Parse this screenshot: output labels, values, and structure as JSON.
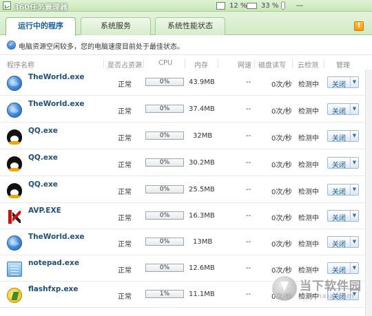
{
  "window": {
    "title": "360任务管理器",
    "cpu_percent": "12 %",
    "mem_percent": "33 %",
    "minimize": "—"
  },
  "tabs": [
    {
      "label": "运行中的程序"
    },
    {
      "label": "系统服务"
    },
    {
      "label": "系统性能状态"
    }
  ],
  "status": {
    "text": "电脑资源空闲较多，您的电脑速度目前处于最佳状态。"
  },
  "columns": {
    "name": "程序名称",
    "resource": "是否占资源",
    "cpu": "CPU",
    "memory": "内存",
    "network": "网速",
    "disk": "磁盘读写",
    "cloud": "云检测",
    "manage": "管理"
  },
  "rows": [
    {
      "icon": "theworld-icon",
      "name": "TheWorld.exe",
      "resource": "正常",
      "cpu": "0%",
      "memory": "43.9MB",
      "network": "--",
      "disk": "0次/秒",
      "cloud": "检测中",
      "action": "关闭"
    },
    {
      "icon": "theworld-icon",
      "name": "TheWorld.exe",
      "resource": "正常",
      "cpu": "0%",
      "memory": "37.4MB",
      "network": "--",
      "disk": "0次/秒",
      "cloud": "检测中",
      "action": "关闭"
    },
    {
      "icon": "qq-icon",
      "name": "QQ.exe",
      "resource": "正常",
      "cpu": "0%",
      "memory": "32MB",
      "network": "--",
      "disk": "0次/秒",
      "cloud": "检测中",
      "action": "关闭"
    },
    {
      "icon": "qq-icon",
      "name": "QQ.exe",
      "resource": "正常",
      "cpu": "0%",
      "memory": "30.2MB",
      "network": "--",
      "disk": "0次/秒",
      "cloud": "检测中",
      "action": "关闭"
    },
    {
      "icon": "qq-icon",
      "name": "QQ.exe",
      "resource": "正常",
      "cpu": "0%",
      "memory": "25.5MB",
      "network": "--",
      "disk": "0次/秒",
      "cloud": "检测中",
      "action": "关闭"
    },
    {
      "icon": "avp-icon",
      "name": "AVP.EXE",
      "resource": "正常",
      "cpu": "0%",
      "memory": "16.3MB",
      "network": "--",
      "disk": "0次/秒",
      "cloud": "检测中",
      "action": "关闭"
    },
    {
      "icon": "theworld-icon",
      "name": "TheWorld.exe",
      "resource": "正常",
      "cpu": "0%",
      "memory": "13MB",
      "network": "--",
      "disk": "0次/秒",
      "cloud": "检测中",
      "action": "关闭"
    },
    {
      "icon": "notepad-icon",
      "name": "notepad.exe",
      "resource": "正常",
      "cpu": "0%",
      "memory": "12.6MB",
      "network": "--",
      "disk": "0次/秒",
      "cloud": "检测中",
      "action": "关闭"
    },
    {
      "icon": "flashfxp-icon",
      "name": "flashfxp.exe",
      "resource": "正常",
      "cpu": "1%",
      "memory": "11.1MB",
      "network": "--",
      "disk": "0次/秒",
      "cloud": "检测中",
      "action": "关闭"
    }
  ],
  "watermark": {
    "text": "当下软件园",
    "url": "downxia.com"
  }
}
